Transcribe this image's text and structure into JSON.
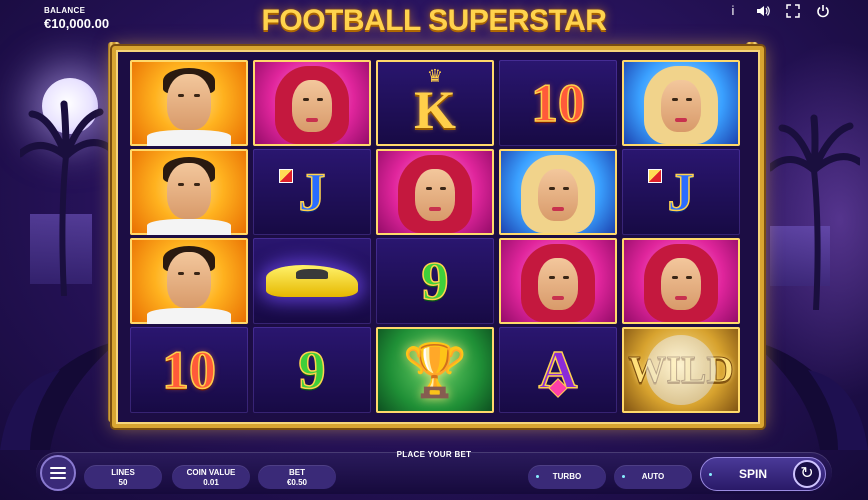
{
  "header": {
    "balance_label": "BALANCE",
    "balance_value": "€10,000.00",
    "logo_text": "FOOTBALL SUPERSTAR",
    "icons": [
      "info-icon",
      "sound-icon",
      "fullscreen-icon",
      "power-icon"
    ]
  },
  "reels": [
    [
      {
        "symbol": "player",
        "style": "orange"
      },
      {
        "symbol": "player",
        "style": "orange"
      },
      {
        "symbol": "player",
        "style": "orange"
      },
      {
        "symbol": "10",
        "style": "red"
      }
    ],
    [
      {
        "symbol": "redhead",
        "style": "pink"
      },
      {
        "symbol": "J",
        "style": "blue"
      },
      {
        "symbol": "car",
        "style": "dark"
      },
      {
        "symbol": "9",
        "style": "green"
      }
    ],
    [
      {
        "symbol": "K",
        "style": "gold"
      },
      {
        "symbol": "redhead",
        "style": "pink"
      },
      {
        "symbol": "9",
        "style": "green"
      },
      {
        "symbol": "trophy",
        "style": "green"
      }
    ],
    [
      {
        "symbol": "10",
        "style": "red"
      },
      {
        "symbol": "blonde",
        "style": "blue"
      },
      {
        "symbol": "redhead",
        "style": "pink"
      },
      {
        "symbol": "A",
        "style": "purple"
      }
    ],
    [
      {
        "symbol": "blonde",
        "style": "blue"
      },
      {
        "symbol": "J",
        "style": "blue"
      },
      {
        "symbol": "redhead",
        "style": "pink"
      },
      {
        "symbol": "WILD",
        "style": "gold"
      }
    ]
  ],
  "bottom": {
    "place_bet": "PLACE YOUR BET",
    "lines_label": "LINES",
    "lines_value": "50",
    "coin_label": "COIN VALUE",
    "coin_value": "0.01",
    "bet_label": "BET",
    "bet_value": "€0.50",
    "turbo_label": "TURBO",
    "auto_label": "AUTO",
    "spin_label": "SPIN"
  },
  "colors": {
    "frame_gold": "#d9a531",
    "background": "#2a1460",
    "logo": "#ffd34d"
  }
}
